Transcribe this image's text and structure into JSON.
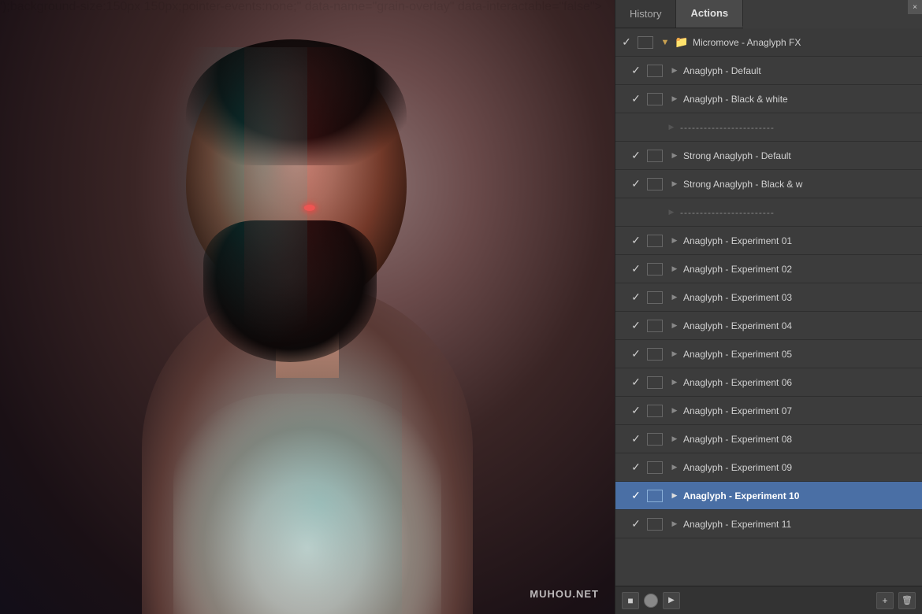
{
  "panel": {
    "close_label": "×",
    "tabs": [
      {
        "id": "history",
        "label": "History",
        "active": false
      },
      {
        "id": "actions",
        "label": "Actions",
        "active": true
      }
    ]
  },
  "actions": {
    "items": [
      {
        "id": 0,
        "checked": true,
        "has_box": true,
        "indent": 0,
        "type": "group",
        "label": "Micromove - Anaglyph FX",
        "expanded": true
      },
      {
        "id": 1,
        "checked": true,
        "has_box": true,
        "indent": 1,
        "type": "action",
        "label": "Anaglyph - Default"
      },
      {
        "id": 2,
        "checked": true,
        "has_box": true,
        "indent": 1,
        "type": "action",
        "label": "Anaglyph - Black & white"
      },
      {
        "id": 3,
        "checked": false,
        "has_box": false,
        "indent": 1,
        "type": "separator",
        "label": "------------------------"
      },
      {
        "id": 4,
        "checked": true,
        "has_box": true,
        "indent": 1,
        "type": "action",
        "label": "Strong Anaglyph - Default"
      },
      {
        "id": 5,
        "checked": true,
        "has_box": true,
        "indent": 1,
        "type": "action",
        "label": "Strong Anaglyph - Black & w"
      },
      {
        "id": 6,
        "checked": false,
        "has_box": false,
        "indent": 1,
        "type": "separator",
        "label": "------------------------"
      },
      {
        "id": 7,
        "checked": true,
        "has_box": true,
        "indent": 1,
        "type": "action",
        "label": "Anaglyph - Experiment 01"
      },
      {
        "id": 8,
        "checked": true,
        "has_box": true,
        "indent": 1,
        "type": "action",
        "label": "Anaglyph - Experiment 02"
      },
      {
        "id": 9,
        "checked": true,
        "has_box": true,
        "indent": 1,
        "type": "action",
        "label": "Anaglyph - Experiment 03"
      },
      {
        "id": 10,
        "checked": true,
        "has_box": true,
        "indent": 1,
        "type": "action",
        "label": "Anaglyph - Experiment 04"
      },
      {
        "id": 11,
        "checked": true,
        "has_box": true,
        "indent": 1,
        "type": "action",
        "label": "Anaglyph - Experiment 05"
      },
      {
        "id": 12,
        "checked": true,
        "has_box": true,
        "indent": 1,
        "type": "action",
        "label": "Anaglyph - Experiment 06"
      },
      {
        "id": 13,
        "checked": true,
        "has_box": true,
        "indent": 1,
        "type": "action",
        "label": "Anaglyph - Experiment 07"
      },
      {
        "id": 14,
        "checked": true,
        "has_box": true,
        "indent": 1,
        "type": "action",
        "label": "Anaglyph - Experiment 08"
      },
      {
        "id": 15,
        "checked": true,
        "has_box": true,
        "indent": 1,
        "type": "action",
        "label": "Anaglyph - Experiment 09"
      },
      {
        "id": 16,
        "checked": true,
        "has_box": true,
        "indent": 1,
        "type": "action",
        "label": "Anaglyph - Experiment 10",
        "selected": true
      },
      {
        "id": 17,
        "checked": true,
        "has_box": true,
        "indent": 1,
        "type": "action",
        "label": "Anaglyph - Experiment 11"
      }
    ]
  },
  "toolbar": {
    "stop_label": "■",
    "record_label": "●",
    "play_label": "▶",
    "new_label": "+"
  },
  "watermark": "MUHOU.NET",
  "colors": {
    "accent_blue": "#4a6fa5",
    "folder_gold": "#c8a050",
    "panel_bg": "#3c3c3c",
    "tab_active_bg": "#4a4a4a",
    "selected_bg": "#4a6fa5"
  }
}
